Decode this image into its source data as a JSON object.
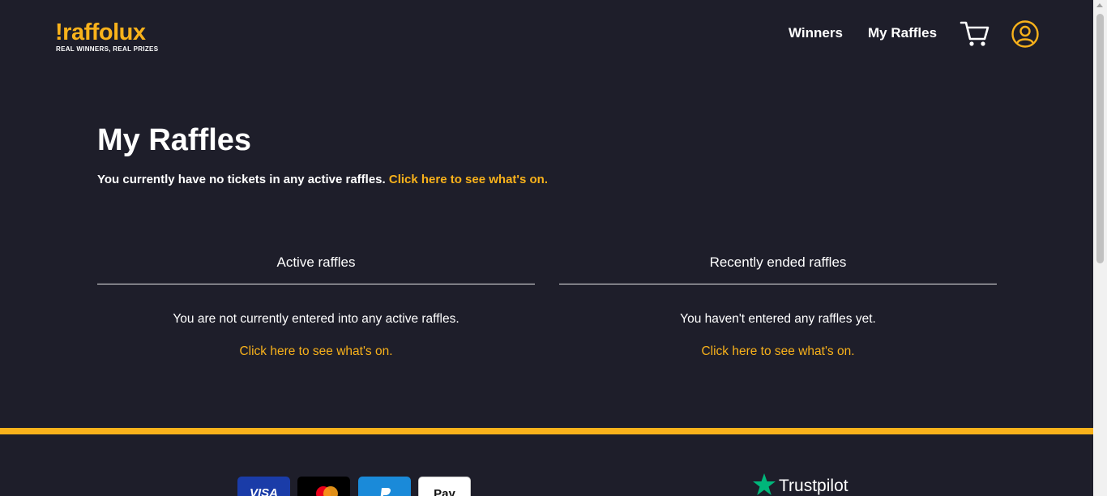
{
  "header": {
    "logo_text": "!raffolux",
    "logo_tagline": "REAL WINNERS, REAL PRIZES",
    "nav": [
      {
        "label": "Winners"
      },
      {
        "label": "My Raffles"
      }
    ],
    "icons": [
      "cart-icon",
      "user-account-icon"
    ]
  },
  "main": {
    "title": "My Raffles",
    "intro_text": "You currently have no tickets in any active raffles.",
    "intro_link": "Click here to see what's on.",
    "panels": [
      {
        "title": "Active raffles",
        "message": "You are not currently entered into any active raffles.",
        "link": "Click here to see what's on."
      },
      {
        "title": "Recently ended raffles",
        "message": "You haven't entered any raffles yet.",
        "link": "Click here to see what's on."
      }
    ]
  },
  "footer": {
    "payments": [
      "VISA",
      "",
      "",
      "Pay"
    ],
    "payment_icons": [
      "visa-icon",
      "mastercard-icon",
      "paypal-icon",
      "apple-pay-icon"
    ],
    "trustpilot_label": "Trustpilot"
  },
  "colors": {
    "background": "#1e1e2a",
    "accent": "#f9b21b",
    "text": "#ffffff"
  }
}
